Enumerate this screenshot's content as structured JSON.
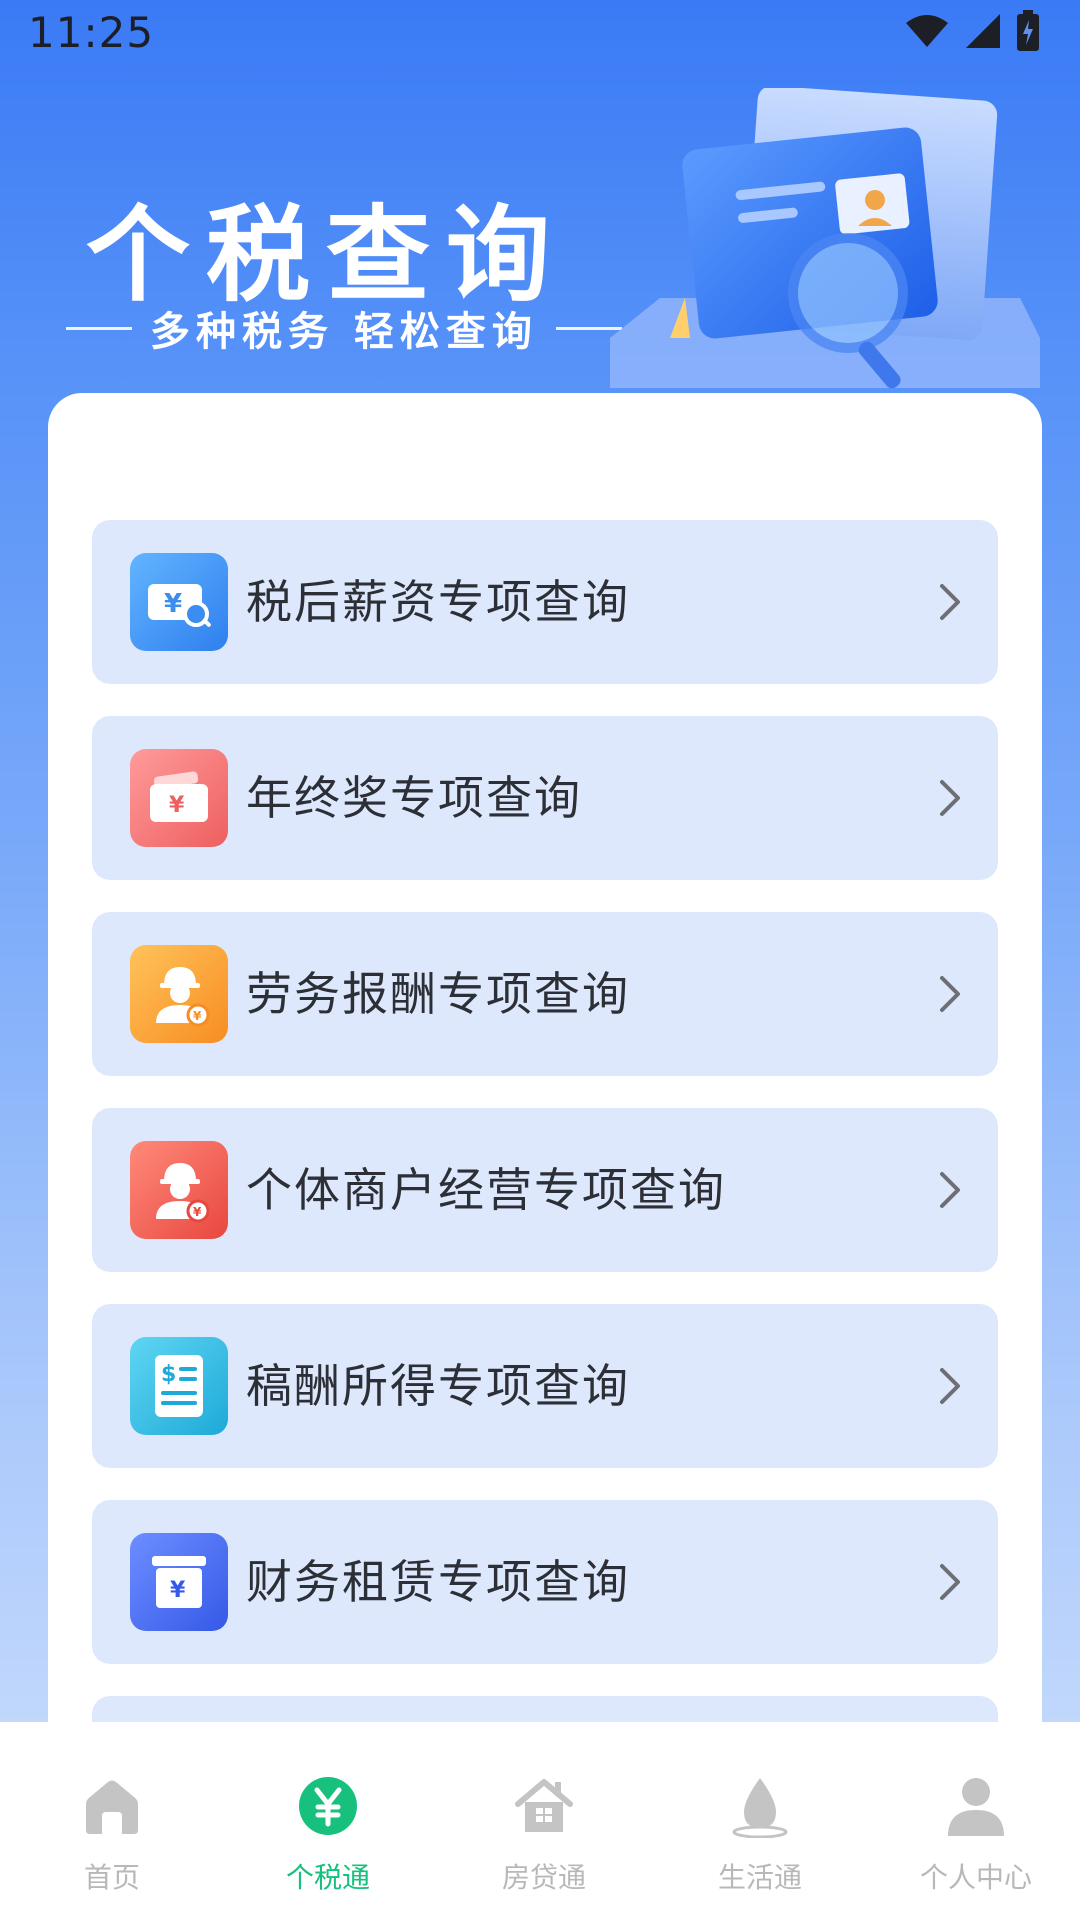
{
  "status_bar": {
    "time": "11:25"
  },
  "header": {
    "title": "个税查询",
    "subtitle": "多种税务 轻松查询"
  },
  "menu": {
    "items": [
      {
        "label": "税后薪资专项查询",
        "icon": "salary-receipt-icon",
        "color": "#3b8ef0"
      },
      {
        "label": "年终奖专项查询",
        "icon": "bonus-wallet-icon",
        "color": "#f26b6b"
      },
      {
        "label": "劳务报酬专项查询",
        "icon": "worker-icon",
        "color": "#f9a23a"
      },
      {
        "label": "个体商户经营专项查询",
        "icon": "merchant-icon",
        "color": "#f06257"
      },
      {
        "label": "稿酬所得专项查询",
        "icon": "document-dollar-icon",
        "color": "#29b8e0"
      },
      {
        "label": "财务租赁专项查询",
        "icon": "lease-box-icon",
        "color": "#4169f0"
      }
    ]
  },
  "bottom_nav": {
    "items": [
      {
        "label": "首页",
        "icon": "home-icon",
        "active": false
      },
      {
        "label": "个税通",
        "icon": "yuan-icon",
        "active": true
      },
      {
        "label": "房贷通",
        "icon": "house-icon",
        "active": false
      },
      {
        "label": "生活通",
        "icon": "water-drop-icon",
        "active": false
      },
      {
        "label": "个人中心",
        "icon": "person-icon",
        "active": false
      }
    ],
    "active_color": "#17c07d",
    "inactive_color": "#b8b8b8"
  }
}
